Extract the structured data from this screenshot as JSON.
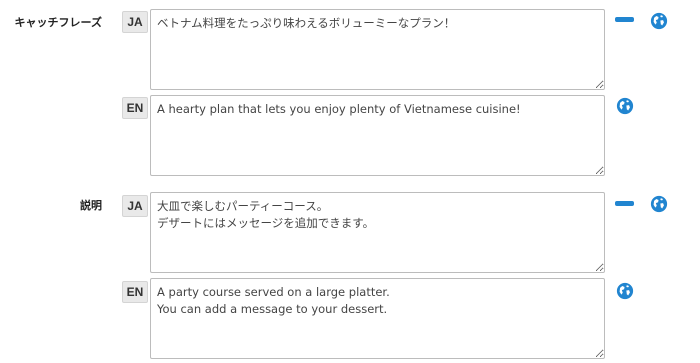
{
  "fields": [
    {
      "label": "キャッチフレーズ",
      "entries": [
        {
          "lang": "JA",
          "value": "ベトナム料理をたっぷり味わえるボリューミーなプラン！",
          "removable": true
        },
        {
          "lang": "EN",
          "value": "A hearty plan that lets you enjoy plenty of Vietnamese cuisine!",
          "removable": false
        }
      ]
    },
    {
      "label": "説明",
      "entries": [
        {
          "lang": "JA",
          "value": "大皿で楽しむパーティーコース。\nデザートにはメッセージを追加できます。",
          "removable": true
        },
        {
          "lang": "EN",
          "value": "A party course served on a large platter.\nYou can add a message to your dessert.",
          "removable": false
        }
      ]
    }
  ],
  "icons": {
    "remove": "minus-icon",
    "translate": "globe-icon"
  },
  "colors": {
    "accent": "#2185d0"
  }
}
